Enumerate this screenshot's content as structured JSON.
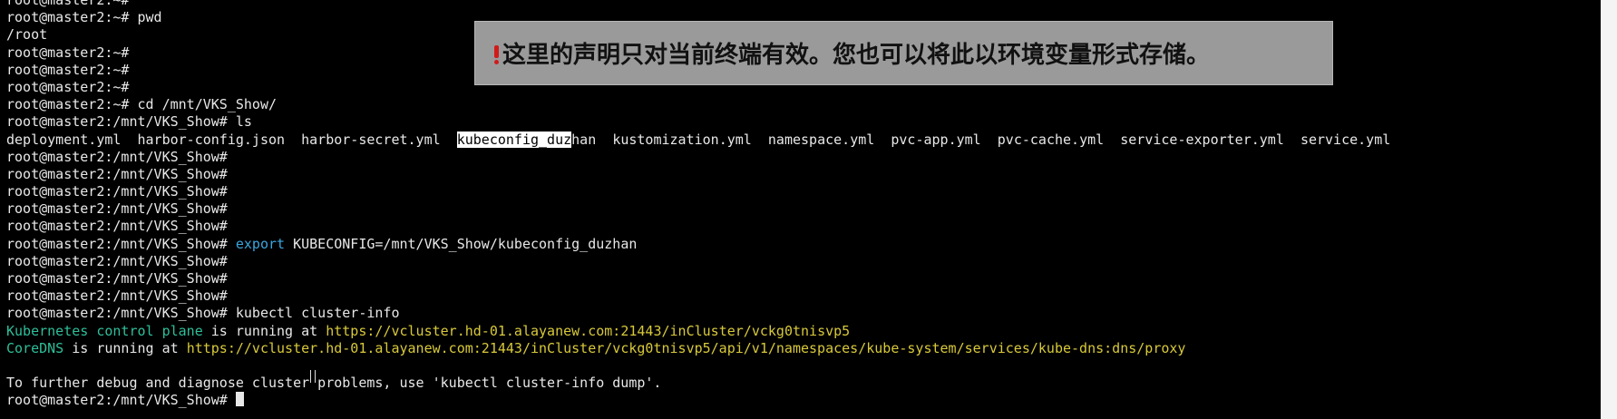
{
  "terminal": {
    "lines": [
      "root@master2:~#",
      "root@master2:~# pwd",
      "/root",
      "root@master2:~#",
      "root@master2:~#",
      "root@master2:~#",
      "root@master2:~# cd /mnt/VKS_Show/",
      "root@master2:/mnt/VKS_Show# ls",
      null,
      "root@master2:/mnt/VKS_Show#",
      "root@master2:/mnt/VKS_Show#",
      "root@master2:/mnt/VKS_Show#",
      "root@master2:/mnt/VKS_Show#",
      "root@master2:/mnt/VKS_Show#",
      null,
      "root@master2:/mnt/VKS_Show#",
      "root@master2:/mnt/VKS_Show#",
      "root@master2:/mnt/VKS_Show#",
      "root@master2:/mnt/VKS_Show# kubectl cluster-info",
      null,
      null,
      "",
      "To further debug and diagnose cluster problems, use 'kubectl cluster-info dump'.",
      null
    ],
    "ls_files": [
      "deployment.yml",
      "harbor-config.json",
      "harbor-secret.yml",
      "kubeconfig_duzhan",
      "kustomization.yml",
      "namespace.yml",
      "pvc-app.yml",
      "pvc-cache.yml",
      "service-exporter.yml",
      "service.yml"
    ],
    "ls_selected_part": "kubeconfig_duz",
    "ls_selected_rest": "han",
    "export_line": {
      "prompt": "root@master2:/mnt/VKS_Show# ",
      "keyword": "export",
      "rest": " KUBECONFIG=/mnt/VKS_Show/kubeconfig_duzhan"
    },
    "k8s_line": {
      "label": "Kubernetes control plane",
      "mid": " is running at ",
      "url": "https://vcluster.hd-01.alayanew.com:21443/inCluster/vckg0tnisvp5"
    },
    "dns_line": {
      "label": "CoreDNS",
      "mid": " is running at ",
      "url": "https://vcluster.hd-01.alayanew.com:21443/inCluster/vckg0tnisvp5/api/v1/namespaces/kube-system/services/kube-dns:dns/proxy"
    },
    "last_prompt": "root@master2:/mnt/VKS_Show# "
  },
  "notice": {
    "text": "这里的声明只对当前终端有效。您也可以将此以环境变量形式存储。",
    "icon": "exclamation-icon"
  },
  "colors": {
    "background": "#000000",
    "text": "#e8e8e8",
    "export_keyword": "#3aa6e0",
    "label_green": "#2ebf9a",
    "url_yellow": "#d8c93a",
    "notice_bg": "#9a9a9a",
    "notice_icon": "#d11a1a"
  }
}
